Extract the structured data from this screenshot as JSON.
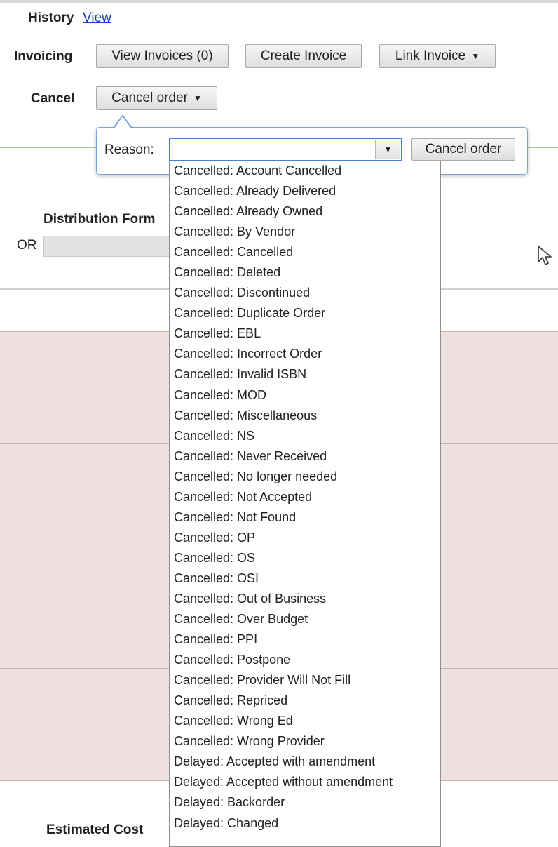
{
  "header": {
    "history_label": "History",
    "history_link": "View",
    "invoicing_label": "Invoicing",
    "view_invoices_button": "View Invoices (0)",
    "create_invoice_button": "Create Invoice",
    "link_invoice_button": "Link Invoice",
    "cancel_label": "Cancel",
    "cancel_order_menu": "Cancel order"
  },
  "cancel_popover": {
    "reason_label": "Reason:",
    "reason_value": "",
    "submit_button": "Cancel order"
  },
  "form": {
    "distribution_label": "Distribution Form",
    "or_label": "OR",
    "estimated_cost_label": "Estimated Cost"
  },
  "reason_options": [
    "Cancelled: Account Cancelled",
    "Cancelled: Already Delivered",
    "Cancelled: Already Owned",
    "Cancelled: By Vendor",
    "Cancelled: Cancelled",
    "Cancelled: Deleted",
    "Cancelled: Discontinued",
    "Cancelled: Duplicate Order",
    "Cancelled: EBL",
    "Cancelled: Incorrect Order",
    "Cancelled: Invalid ISBN",
    "Cancelled: MOD",
    "Cancelled: Miscellaneous",
    "Cancelled: NS",
    "Cancelled: Never Received",
    "Cancelled: No longer needed",
    "Cancelled: Not Accepted",
    "Cancelled: Not Found",
    "Cancelled: OP",
    "Cancelled: OS",
    "Cancelled: OSI",
    "Cancelled: Out of Business",
    "Cancelled: Over Budget",
    "Cancelled: PPI",
    "Cancelled: Postpone",
    "Cancelled: Provider Will Not Fill",
    "Cancelled: Repriced",
    "Cancelled: Wrong Ed",
    "Cancelled: Wrong Provider",
    "Delayed: Accepted with amendment",
    "Delayed: Accepted without amendment",
    "Delayed: Backorder",
    "Delayed: Changed"
  ],
  "icons": {
    "dropdown_caret": "caret-down-icon",
    "mouse_cursor": "arrow-cursor-icon"
  },
  "colors": {
    "link": "#1a3bd0",
    "popover_border": "#7aa7d8",
    "section_divider": "#8fcf7c",
    "row_background": "#efe0e0"
  }
}
